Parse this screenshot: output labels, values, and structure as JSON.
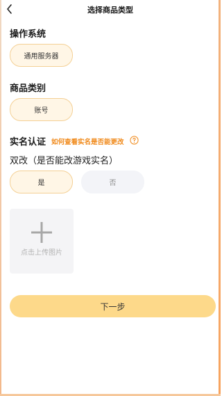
{
  "header": {
    "title": "选择商品类型",
    "back_icon": "chevron-left-icon"
  },
  "os_section": {
    "title": "操作系统",
    "options": [
      "通用服务器"
    ],
    "selected": "通用服务器"
  },
  "category_section": {
    "title": "商品类别",
    "options": [
      "账号"
    ],
    "selected": "账号"
  },
  "realname_section": {
    "title": "实名认证",
    "hint_link": "如何查看实名是否能更改",
    "help_icon": "question-circle-icon",
    "question": "双改（是否能改游戏实名）",
    "options": [
      "是",
      "否"
    ],
    "selected": "是"
  },
  "upload": {
    "icon": "plus-icon",
    "label": "点击上传图片"
  },
  "next_button": {
    "label": "下一步"
  },
  "colors": {
    "accent": "#f08a1c",
    "chip_selected_bg": "#fff6e6",
    "chip_selected_border": "#f4d095",
    "button_bg": "#fdd98a"
  }
}
